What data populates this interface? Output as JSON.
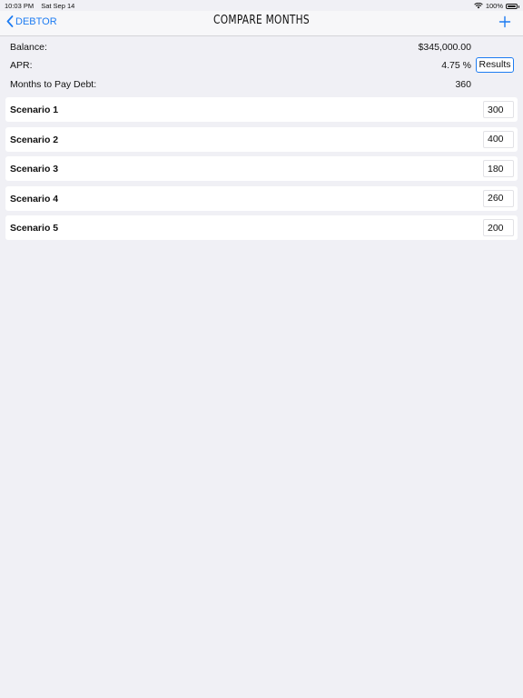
{
  "status_bar": {
    "time": "10:03 PM",
    "date": "Sat Sep 14",
    "battery": "100%"
  },
  "nav": {
    "back_label": "DEBTOR",
    "title": "COMPARE MONTHS",
    "add_icon": "plus-icon"
  },
  "info": {
    "balance_label": "Balance:",
    "balance_value": "$345,000.00",
    "apr_label": "APR:",
    "apr_value": "4.75 %",
    "months_label": "Months to Pay Debt:",
    "months_value": "360",
    "results_label": "Results"
  },
  "scenarios": [
    {
      "label": "Scenario 1",
      "value": "300"
    },
    {
      "label": "Scenario 2",
      "value": "400"
    },
    {
      "label": "Scenario 3",
      "value": "180"
    },
    {
      "label": "Scenario 4",
      "value": "260"
    },
    {
      "label": "Scenario 5",
      "value": "200"
    }
  ],
  "colors": {
    "accent": "#1e7cf2",
    "background": "#f0f0f5",
    "card": "#ffffff"
  }
}
